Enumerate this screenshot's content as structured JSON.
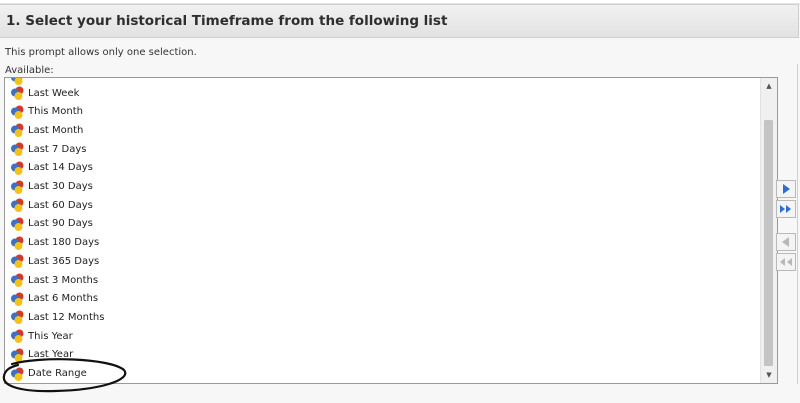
{
  "header": {
    "title": "1.  Select your historical Timeframe from the following list"
  },
  "prompt": {
    "note": "This prompt allows only one selection.",
    "available_label": "Available:"
  },
  "list": {
    "items": [
      {
        "label": "Last  Week"
      },
      {
        "label": "This Month"
      },
      {
        "label": "Last Month"
      },
      {
        "label": "Last 7 Days"
      },
      {
        "label": "Last 14 Days"
      },
      {
        "label": "Last 30 Days"
      },
      {
        "label": "Last 60 Days"
      },
      {
        "label": "Last 90 Days"
      },
      {
        "label": "Last 180 Days"
      },
      {
        "label": "Last 365 Days"
      },
      {
        "label": "Last 3 Months"
      },
      {
        "label": "Last 6 Months"
      },
      {
        "label": "Last 12 Months"
      },
      {
        "label": "This Year"
      },
      {
        "label": "Last Year"
      },
      {
        "label": "Date Range"
      }
    ]
  },
  "colors": {
    "icon_blue": "#3d6fc4",
    "icon_red": "#d23a2a",
    "icon_yellow": "#f2c21b",
    "button_arrow_blue": "#2d6fd0",
    "button_arrow_disabled": "#b8b8b8",
    "annotation_ellipse": "#111111"
  },
  "icons": {
    "list_item": "prompt-object-icon",
    "add": "arrow-right-icon",
    "add_all": "double-arrow-right-icon",
    "remove": "arrow-left-icon",
    "remove_all": "double-arrow-left-icon",
    "scroll_up": "triangle-up-icon",
    "scroll_down": "triangle-down-icon"
  }
}
